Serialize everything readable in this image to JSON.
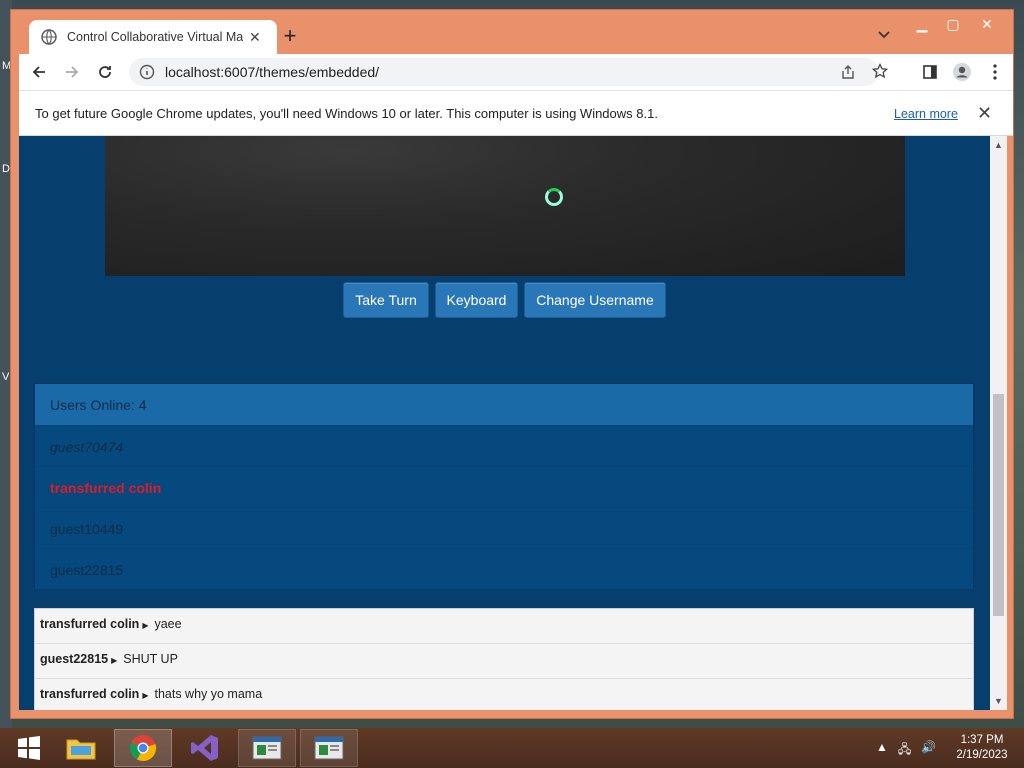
{
  "desktop": {
    "letters": [
      "M",
      "D",
      "V"
    ]
  },
  "browser": {
    "tab_title": "Control Collaborative Virtual Ma",
    "url": "localhost:6007/themes/embedded/",
    "infobar": {
      "text": "To get future Google Chrome updates, you'll need Windows 10 or later. This computer is using Windows 8.1.",
      "link": "Learn more"
    }
  },
  "vm": {
    "buttons": {
      "take_turn": "Take Turn",
      "keyboard": "Keyboard",
      "change_username": "Change Username"
    }
  },
  "users": {
    "header": "Users Online: 4",
    "list": [
      "guest70474",
      "transfurred colin",
      "guest10449",
      "guest22815"
    ]
  },
  "chat": {
    "messages": [
      {
        "user": "transfurred colin",
        "text": "yaee"
      },
      {
        "user": "guest22815",
        "text": "SHUT UP"
      },
      {
        "user": "transfurred colin",
        "text": "thats why yo mama"
      }
    ]
  },
  "taskbar": {
    "time": "1:37 PM",
    "date": "2/19/2023"
  },
  "colors": {
    "page_bg": "#063e6e",
    "button_bg": "#2a77b8",
    "highlight_user": "#e01b24",
    "window_frame": "#e8916a"
  }
}
